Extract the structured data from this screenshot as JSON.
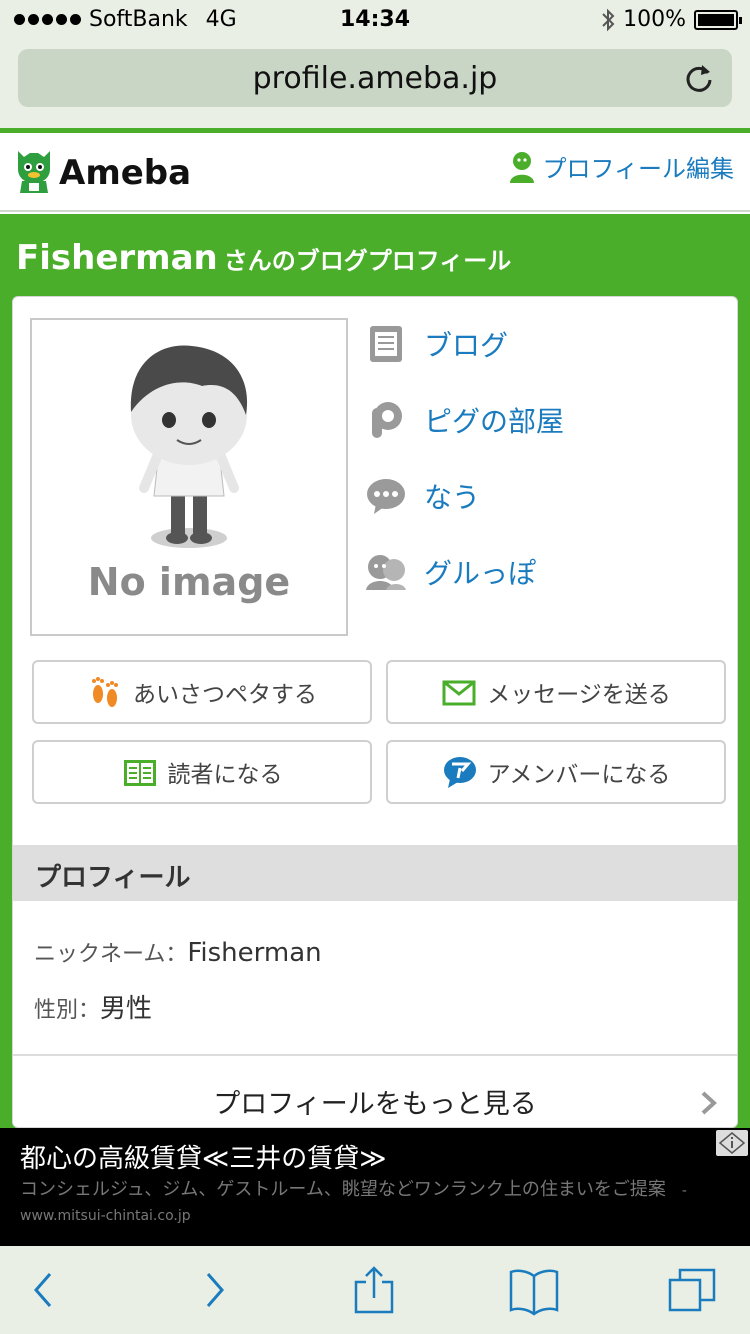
{
  "status_bar": {
    "carrier": "SoftBank",
    "network": "4G",
    "time": "14:34",
    "battery": "100%"
  },
  "browser": {
    "url": "profile.ameba.jp"
  },
  "header": {
    "logo_text": "Ameba",
    "profile_edit_label": "プロフィール編集"
  },
  "page_title": {
    "name": "Fisherman",
    "suffix": "さんのブログプロフィール"
  },
  "avatar": {
    "placeholder_text": "No image"
  },
  "links": [
    {
      "label": "ブログ",
      "icon": "blog-icon"
    },
    {
      "label": "ピグの部屋",
      "icon": "pigg-icon"
    },
    {
      "label": "なう",
      "icon": "now-icon"
    },
    {
      "label": "グルっぽ",
      "icon": "group-icon"
    }
  ],
  "buttons": {
    "greet": "あいさつペタする",
    "message": "メッセージを送る",
    "reader": "読者になる",
    "amember": "アメンバーになる"
  },
  "profile": {
    "heading": "プロフィール",
    "nickname_label": "ニックネーム：",
    "nickname_value": "Fisherman",
    "gender_label": "性別：",
    "gender_value": "男性",
    "more_label": "プロフィールをもっと見る"
  },
  "ad": {
    "title": "都心の高級賃貸≪三井の賃貸≫",
    "description": "コンシェルジュ、ジム、ゲストルーム、眺望などワンランク上の住まいをご提案",
    "url": "- www.mitsui-chintai.co.jp"
  },
  "colors": {
    "accent_green": "#4aae2a",
    "link_blue": "#1a7bbf"
  }
}
